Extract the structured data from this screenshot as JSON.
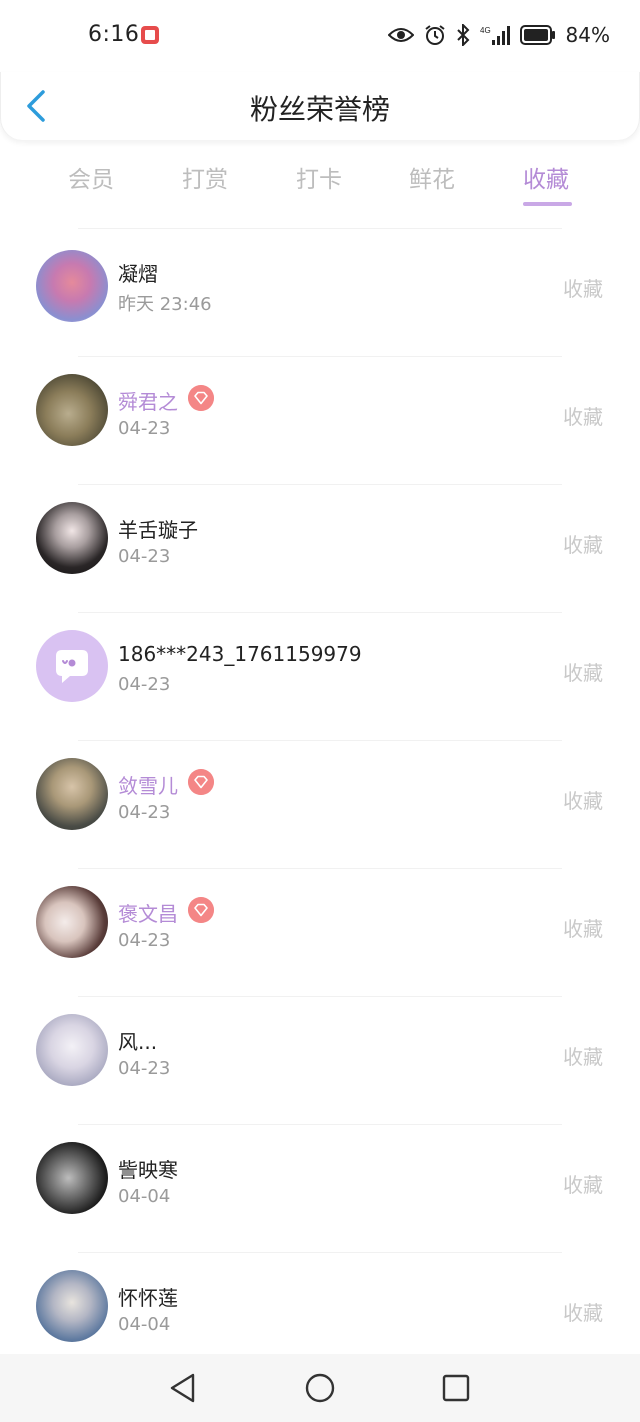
{
  "status_bar": {
    "time": "6:16",
    "battery": "84%"
  },
  "header": {
    "title": "粉丝荣誉榜"
  },
  "tabs": [
    {
      "label": "会员"
    },
    {
      "label": "打赏"
    },
    {
      "label": "打卡"
    },
    {
      "label": "鲜花"
    },
    {
      "label": "收藏"
    }
  ],
  "active_tab": "收藏",
  "colors": {
    "accent": "#b48bd6",
    "badge": "#f48686",
    "back_arrow": "#2d9cdb",
    "action_text": "#c9c9c9"
  },
  "fans": [
    {
      "name": "凝熠",
      "date": "昨天 23:46",
      "vip": false,
      "action": "收藏"
    },
    {
      "name": "舜君之",
      "date": "04-23",
      "vip": true,
      "action": "收藏"
    },
    {
      "name": "羊舌璇子",
      "date": "04-23",
      "vip": false,
      "action": "收藏"
    },
    {
      "name": "186***243_1761159979",
      "date": "04-23",
      "vip": false,
      "action": "收藏"
    },
    {
      "name": "敛雪儿",
      "date": "04-23",
      "vip": true,
      "action": "收藏"
    },
    {
      "name": "褒文昌",
      "date": "04-23",
      "vip": true,
      "action": "收藏"
    },
    {
      "name": "风...",
      "date": "04-23",
      "vip": false,
      "action": "收藏"
    },
    {
      "name": "訾映寒",
      "date": "04-04",
      "vip": false,
      "action": "收藏"
    },
    {
      "name": "怀怀莲",
      "date": "04-04",
      "vip": false,
      "action": "收藏"
    }
  ]
}
